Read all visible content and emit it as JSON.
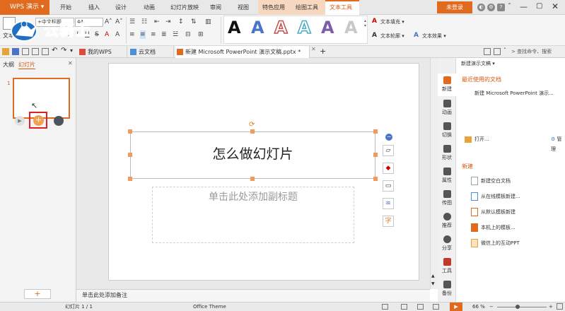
{
  "titlebar": {
    "app_name": "WPS 演示",
    "menus": [
      "开始",
      "插入",
      "设计",
      "动画",
      "幻灯片放映",
      "审阅",
      "视图",
      "特色应用",
      "绘图工具",
      "文本工具"
    ],
    "active_menu": "文本工具",
    "login": "未登录",
    "accent": "#e06a1e"
  },
  "ribbon": {
    "textbox_label": "文本框",
    "font_name": "+中文标题",
    "font_size": "44",
    "wordart_letter": "A",
    "text_fill": "文本填充",
    "text_outline": "文本轮廓",
    "text_effects": "文本效果"
  },
  "watermark": {
    "text": "云骑士"
  },
  "tabs": {
    "items": [
      "我的WPS",
      "云文档",
      "新建 Microsoft PowerPoint 演示文稿.pptx *"
    ],
    "search": "查找命令、搜索"
  },
  "leftpanel": {
    "tab_outline": "大纲",
    "tab_slides": "幻灯片",
    "slide_number": "1",
    "add_button": "+"
  },
  "slide": {
    "title": "怎么做幻灯片",
    "subtitle_placeholder": "单击此处添加副标题"
  },
  "notes": {
    "placeholder": "单击此处添加备注"
  },
  "sidenav": {
    "items": [
      "新建",
      "动画",
      "切换",
      "形状",
      "属性",
      "传图",
      "推荐",
      "分享",
      "工具",
      "备份"
    ]
  },
  "rightpanel": {
    "header": "新建演示文稿",
    "recent_title": "最近使用的文档",
    "recent_doc": "新建 Microsoft PowerPoint 演示...",
    "open": "打开...",
    "manage": "管理",
    "new_title": "新建",
    "new_items": [
      "新建空白文档",
      "从在线模板新建...",
      "从默认模板新建",
      "本机上的模板...",
      "微信上的互动PPT"
    ]
  },
  "status": {
    "slide_info": "幻灯片 1 / 1",
    "theme": "Office Theme",
    "zoom": "66 %"
  }
}
